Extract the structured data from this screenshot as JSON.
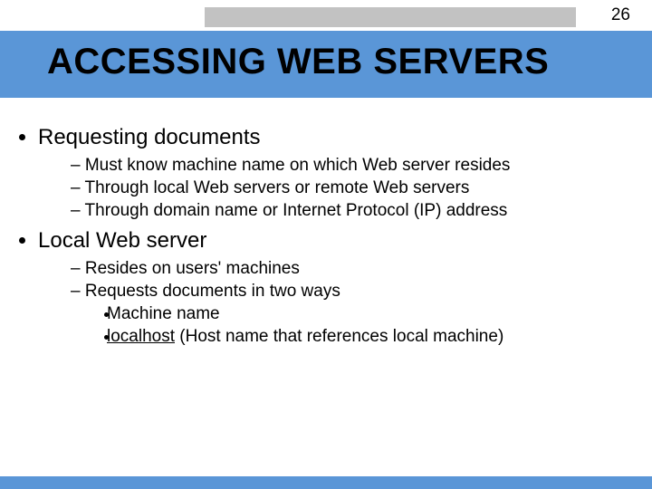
{
  "page_number": "26",
  "title": "ACCESSING WEB SERVERS",
  "section1": {
    "heading": "Requesting documents",
    "items": [
      "Must know machine name on which Web server resides",
      "Through local Web servers or remote Web servers",
      "Through domain name or Internet Protocol (IP) address"
    ]
  },
  "section2": {
    "heading": "Local Web server",
    "items": [
      "Resides on users' machines",
      "Requests documents in two ways"
    ],
    "subitems": {
      "0": "Machine name",
      "1_prefix": "localhost",
      "1_suffix": " (Host name that references local machine)"
    }
  }
}
